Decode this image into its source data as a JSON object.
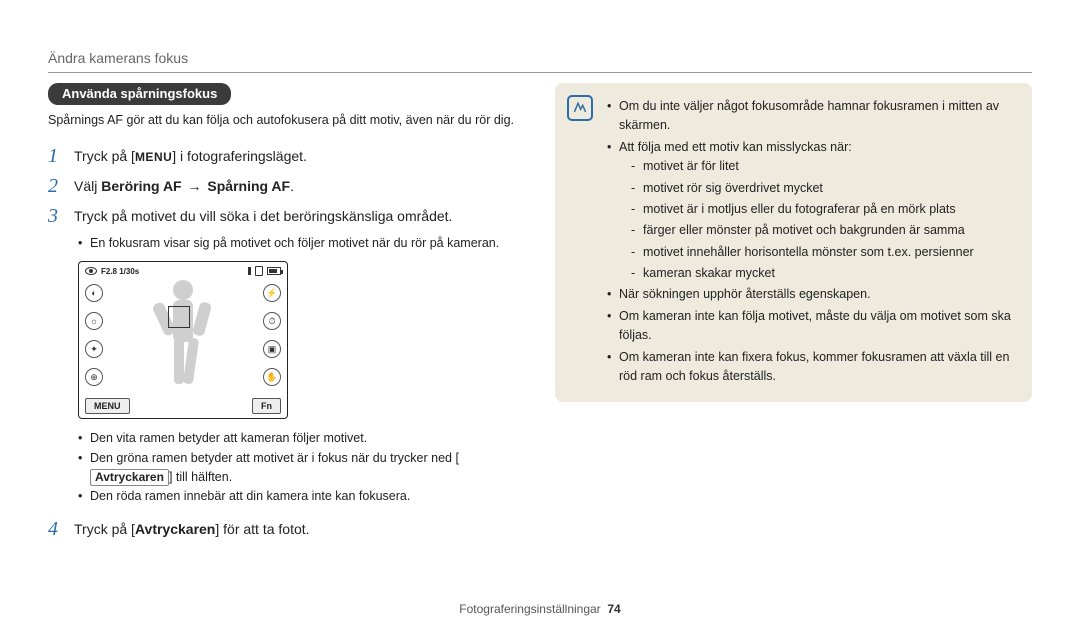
{
  "header": {
    "breadcrumb": "Ändra kamerans fokus"
  },
  "section": {
    "badge": "Använda spårningsfokus",
    "intro": "Spårnings AF gör att du kan följa och autofokusera på ditt motiv, även när du rör dig."
  },
  "steps": {
    "s1_pre": "Tryck på [",
    "s1_menu": "MENU",
    "s1_post": "] i fotograferingsläget.",
    "s2_pre": "Välj ",
    "s2_b1": "Beröring AF",
    "s2_arrow": "→",
    "s2_b2": "Spårning AF",
    "s2_post": ".",
    "s3": "Tryck på motivet du vill söka i det beröringskänsliga området.",
    "s3_sub1": "En fokusram visar sig på motivet och följer motivet när du rör på kameran.",
    "post_screen_b1": "Den vita ramen betyder att kameran följer motivet.",
    "post_screen_b2_pre": "Den gröna ramen betyder att motivet är i fokus när du trycker ned [",
    "post_screen_b2_btn": "Avtryckaren",
    "post_screen_b2_post": "] till hälften.",
    "post_screen_b3": "Den röda ramen innebär att din kamera inte kan fokusera.",
    "s4_pre": "Tryck på [",
    "s4_btn": "Avtryckaren",
    "s4_post": "] för att ta fotot."
  },
  "screen": {
    "exposure": "F2.8 1/30s",
    "menu_btn": "MENU",
    "fn_btn": "Fn"
  },
  "note": {
    "n1": "Om du inte väljer något fokusområde hamnar fokusramen i mitten av skärmen.",
    "n2": "Att följa med ett motiv kan misslyckas när:",
    "d1": "motivet är för litet",
    "d2": "motivet rör sig överdrivet mycket",
    "d3": "motivet är i motljus eller du fotograferar på en mörk plats",
    "d4": "färger eller mönster på motivet och bakgrunden är samma",
    "d5": "motivet innehåller horisontella mönster som t.ex. persienner",
    "d6": "kameran skakar mycket",
    "n3": "När sökningen upphör återställs egenskapen.",
    "n4": "Om kameran inte kan följa motivet, måste du välja om motivet som ska följas.",
    "n5": "Om kameran inte kan fixera fokus, kommer fokusramen att växla till en röd ram och fokus återställs."
  },
  "footer": {
    "section": "Fotograferingsinställningar",
    "page": "74"
  }
}
